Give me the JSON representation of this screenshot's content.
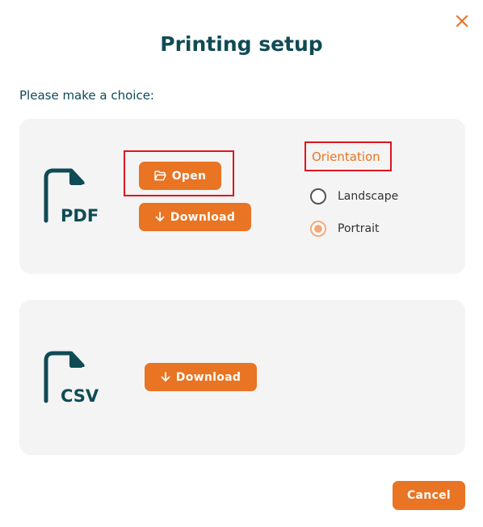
{
  "dialog": {
    "title": "Printing setup",
    "prompt": "Please make a choice:",
    "close_icon": "close-icon"
  },
  "pdf": {
    "icon_label": "PDF",
    "open_label": "Open",
    "download_label": "Download",
    "orientation_label": "Orientation",
    "orientation_options": [
      {
        "label": "Landscape",
        "checked": false
      },
      {
        "label": "Portrait",
        "checked": true
      }
    ]
  },
  "csv": {
    "icon_label": "CSV",
    "download_label": "Download"
  },
  "footer": {
    "cancel_label": "Cancel"
  },
  "colors": {
    "accent": "#e97423",
    "title": "#0f4b55",
    "card": "#f4f4f4",
    "highlight": "#e0141e"
  }
}
